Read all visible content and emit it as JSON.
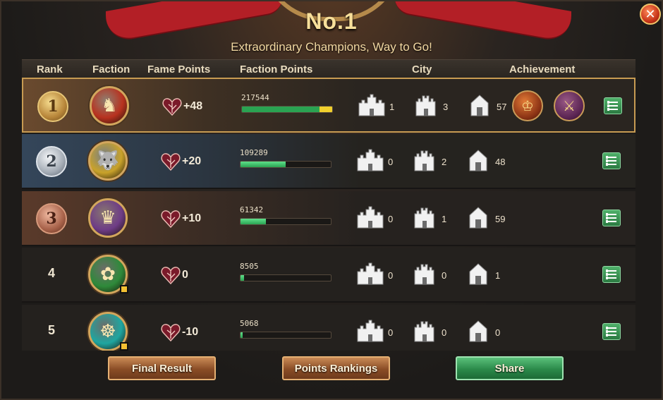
{
  "header": {
    "title": "No.1",
    "subtitle": "Extraordinary Champions, Way to Go!"
  },
  "columns": {
    "rank": "Rank",
    "faction": "Faction",
    "fame_points": "Fame Points",
    "faction_points": "Faction Points",
    "city": "City",
    "achievement": "Achievement"
  },
  "rows": [
    {
      "rank": "1",
      "faction_icon": "lion-crest-icon",
      "faction_color": "#b8321f",
      "fame": "+48",
      "faction_points": "217544",
      "progress": 1.0,
      "city_large": "1",
      "city_medium": "3",
      "city_small": "57",
      "achievements": [
        "horned-crown-achievement-icon",
        "winged-sword-achievement-icon"
      ]
    },
    {
      "rank": "2",
      "faction_icon": "direwolf-crest-icon",
      "faction_color": "#c9a22a",
      "fame": "+20",
      "faction_points": "109289",
      "progress": 0.5,
      "city_large": "0",
      "city_medium": "2",
      "city_small": "48",
      "achievements": []
    },
    {
      "rank": "3",
      "faction_icon": "dragon-crest-icon",
      "faction_color": "#6e3c86",
      "fame": "+10",
      "faction_points": "61342",
      "progress": 0.28,
      "city_large": "0",
      "city_medium": "1",
      "city_small": "59",
      "achievements": []
    },
    {
      "rank": "4",
      "faction_icon": "rose-crest-icon",
      "faction_color": "#2e8a3a",
      "fame": "0",
      "faction_points": "8505",
      "progress": 0.04,
      "city_large": "0",
      "city_medium": "0",
      "city_small": "1",
      "achievements": []
    },
    {
      "rank": "5",
      "faction_icon": "kraken-crest-icon",
      "faction_color": "#1fa6a0",
      "fame": "-10",
      "faction_points": "5068",
      "progress": 0.02,
      "city_large": "0",
      "city_medium": "0",
      "city_small": "0",
      "achievements": []
    }
  ],
  "buttons": {
    "final_result": "Final Result",
    "points_rankings": "Points Rankings",
    "share": "Share"
  },
  "colors": {
    "accent_gold": "#c79b52",
    "progress_green": "#2aa352",
    "progress_yellow": "#f1d02d"
  }
}
